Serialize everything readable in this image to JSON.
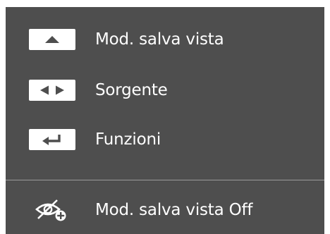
{
  "menu": {
    "items": [
      {
        "key_icon": "up-arrow-icon",
        "label": "Mod. salva vista"
      },
      {
        "key_icon": "left-right-arrow-icon",
        "label": "Sorgente"
      },
      {
        "key_icon": "enter-return-icon",
        "label": "Funzioni"
      }
    ],
    "footer": {
      "icon": "eye-saver-off-icon",
      "label": "Mod. salva vista Off"
    }
  },
  "colors": {
    "panel_background": "#4e4e4e",
    "key_background": "#ffffff",
    "key_glyph": "#4e4e4e",
    "text": "#ffffff",
    "divider": "#9a9a9a"
  }
}
